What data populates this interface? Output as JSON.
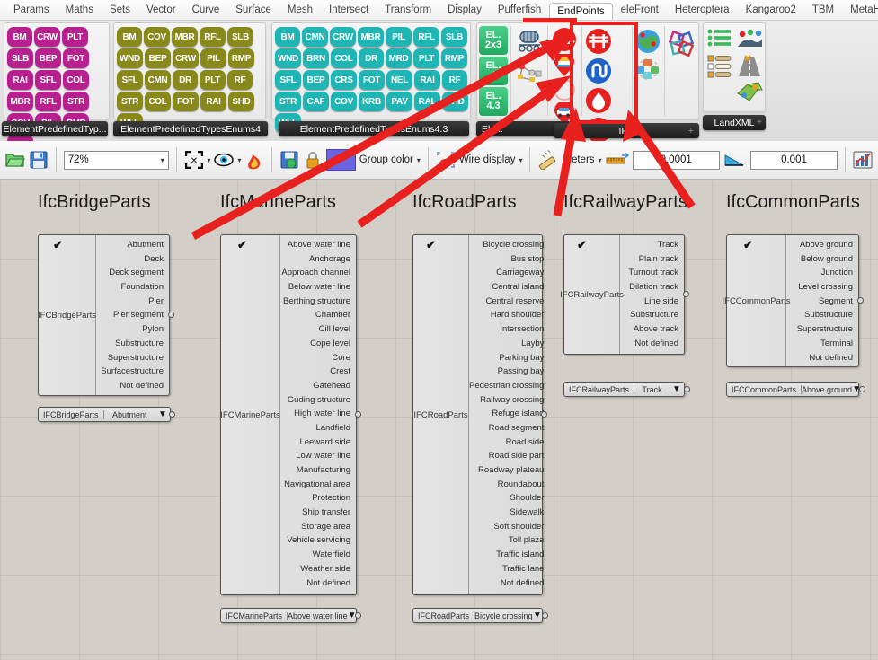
{
  "menu": {
    "items": [
      {
        "label": "Params",
        "active": false
      },
      {
        "label": "Maths",
        "active": false
      },
      {
        "label": "Sets",
        "active": false
      },
      {
        "label": "Vector",
        "active": false
      },
      {
        "label": "Curve",
        "active": false
      },
      {
        "label": "Surface",
        "active": false
      },
      {
        "label": "Mesh",
        "active": false
      },
      {
        "label": "Intersect",
        "active": false
      },
      {
        "label": "Transform",
        "active": false
      },
      {
        "label": "Display",
        "active": false
      },
      {
        "label": "Pufferfish",
        "active": false
      },
      {
        "label": "EndPoints",
        "active": true
      },
      {
        "label": "eleFront",
        "active": false
      },
      {
        "label": "Heteroptera",
        "active": false
      },
      {
        "label": "Kangaroo2",
        "active": false
      },
      {
        "label": "TBM",
        "active": false
      },
      {
        "label": "MetaHopper",
        "active": false
      }
    ]
  },
  "ribbon": {
    "panels": [
      {
        "name": "ElementPredefinedTypes",
        "tab_label": "ElementPredefinedTyp...",
        "color": "#b8208f",
        "buttons": [
          "BM",
          "CRW",
          "PLT",
          "SLB",
          "BEP",
          "FOT",
          "RAI",
          "SFL",
          "COL",
          "MBR",
          "RFL",
          "STR",
          "COV",
          "PIL",
          "RMP",
          "WLL"
        ]
      },
      {
        "name": "ElementPredefinedTypesEnums4",
        "tab_label": "ElementPredefinedTypesEnums4",
        "color": "#88881b",
        "buttons": [
          "BM",
          "COV",
          "MBR",
          "RFL",
          "SLB",
          "WND",
          "BEP",
          "CRW",
          "PIL",
          "RMP",
          "SFL",
          "CMN",
          "DR",
          "PLT",
          "RF",
          "STR",
          "COL",
          "FOT",
          "RAI",
          "SHD",
          "WLL"
        ]
      },
      {
        "name": "ElementPredefinedTypesEnums43",
        "tab_label": "ElementPredefinedTypesEnums4.3",
        "color": "#1fb5b5",
        "buttons": [
          "BM",
          "CMN",
          "CRW",
          "MBR",
          "PIL",
          "RFL",
          "SLB",
          "WND",
          "BRN",
          "COL",
          "DR",
          "MRD",
          "PLT",
          "RMP",
          "SFL",
          "BEP",
          "CRS",
          "FOT",
          "NEL",
          "RAI",
          "RF",
          "STR",
          "CAF",
          "COV",
          "KRB",
          "PAV",
          "RAL",
          "SHD",
          "WLL"
        ]
      }
    ],
    "el_panel": {
      "tab_label": "Ele...",
      "color": "#2eb56a",
      "buttons": [
        "EL. 2x3",
        "EL. 4",
        "EL. 4.3"
      ]
    },
    "ifc_panel": {
      "tab_label": "IFC",
      "accent": "#e8201e",
      "icon_groups": [
        {
          "icons": [
            "ifc-conveyor-icon",
            "ifc-graph-icon"
          ]
        },
        {
          "icons": [
            "ifc-bridge-pin-icon",
            "ifc-marine-pin-icon",
            "ifc-circle-icon",
            "ifc-road-pin-icon"
          ]
        },
        {
          "icons": [
            "ifc-bridge-icon",
            "ifc-alignment-icon",
            "ifc-marine-icon",
            "ifc-railway-icon"
          ]
        },
        {
          "icons": [
            "ifc-globe-icon",
            "ifc-cluster-icon",
            "ifc-knot-icon"
          ]
        }
      ]
    },
    "landxml_panel": {
      "tab_label": "LandXML",
      "icons": [
        "list-green-icon",
        "list-orange-icon",
        "survey-icon",
        "road-tools-icon",
        "surface-icon"
      ]
    }
  },
  "options_bar": {
    "open_label": "open-file-icon",
    "save_label": "save-file-icon",
    "zoom_value": "72%",
    "focus_icon": "focus-icon",
    "preview_icon": "eye-preview-icon",
    "bake_icon": "bake-icon",
    "savedoc_icon": "save-document-icon",
    "lock_icon": "lock-icon",
    "color_swatch": "#6c63e0",
    "group_color_label": "Group color",
    "wire_display_label": "Wire display",
    "units_label": "Meters",
    "ruler_icon": "ruler-icon",
    "tolerance_value": "0.0001",
    "angle_icon": "angle-icon",
    "angle_value": "0.001",
    "chart_icon": "chart-icon"
  },
  "canvas": {
    "groups": [
      {
        "title": "IfcBridgeParts",
        "node_label": "IFCBridgeParts",
        "selected": "Abutment",
        "items": [
          "Abutment",
          "Deck",
          "Deck segment",
          "Foundation",
          "Pier",
          "Pier segment",
          "Pylon",
          "Substructure",
          "Superstructure",
          "Surfacestructure",
          "Not defined"
        ]
      },
      {
        "title": "IfcMarineParts",
        "node_label": "IFCMarineParts",
        "selected": "Above water line",
        "items": [
          "Above water line",
          "Anchorage",
          "Approach channel",
          "Below water line",
          "Berthing structure",
          "Chamber",
          "Cill level",
          "Cope level",
          "Core",
          "Crest",
          "Gatehead",
          "Guding structure",
          "High water line",
          "Landfield",
          "Leeward side",
          "Low water line",
          "Manufacturing",
          "Navigational area",
          "Protection",
          "Ship transfer",
          "Storage area",
          "Vehicle servicing",
          "Waterfield",
          "Weather side",
          "Not defined"
        ]
      },
      {
        "title": "IfcRoadParts",
        "node_label": "IFCRoadParts",
        "selected": "Bicycle crossing",
        "items": [
          "Bicycle crossing",
          "Bus stop",
          "Carriageway",
          "Central island",
          "Central reserve",
          "Hard shoulder",
          "Intersection",
          "Layby",
          "Parking bay",
          "Passing bay",
          "Pedestrian crossing",
          "Railway crossing",
          "Refuge island",
          "Road segment",
          "Road side",
          "Road side part",
          "Roadway plateau",
          "Roundabout",
          "Shoulder",
          "Sidewalk",
          "Soft shoulder",
          "Toll plaza",
          "Traffic island",
          "Traffic lane",
          "Not defined"
        ]
      },
      {
        "title": "IfcRailwayParts",
        "node_label": "IFCRailwayParts",
        "selected": "Track",
        "items": [
          "Track",
          "Plain track",
          "Turnout track",
          "Dilation track",
          "Line side",
          "Substructure",
          "Above track",
          "Not defined"
        ]
      },
      {
        "title": "IfcCommonParts",
        "node_label": "IFCCommonParts",
        "selected": "Above ground",
        "items": [
          "Above ground",
          "Below ground",
          "Junction",
          "Level crossing",
          "Segment",
          "Substructure",
          "Superstructure",
          "Terminal",
          "Not defined"
        ]
      }
    ]
  },
  "annotations": {
    "highlight_color": "#e8201e",
    "arrows": [
      {
        "name": "arrow-to-ifc-panel-from-bridge"
      },
      {
        "name": "arrow-to-ifc-panel-from-marine"
      },
      {
        "name": "arrow-to-ifc-panel-from-road"
      },
      {
        "name": "arrow-to-ifc-panel-from-railway"
      },
      {
        "name": "arrow-to-ifc-panel-from-common"
      }
    ]
  }
}
